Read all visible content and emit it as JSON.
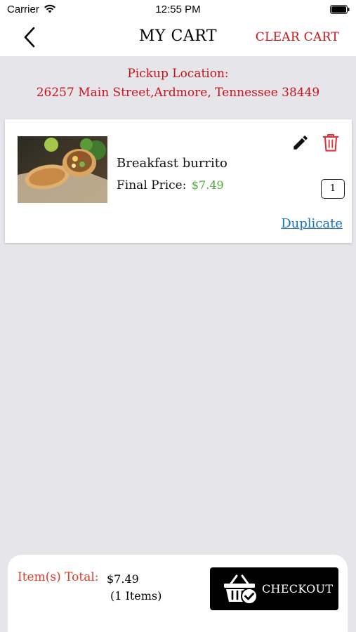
{
  "status": {
    "carrier": "Carrier",
    "time": "12:55 PM"
  },
  "header": {
    "title": "MY CART",
    "clear_label": "CLEAR CART",
    "back_icon": "chevron-left-icon"
  },
  "pickup": {
    "label": "Pickup Location:",
    "address": "26257 Main Street,Ardmore,  Tennessee 38449"
  },
  "cart": {
    "items": [
      {
        "name": "Breakfast burrito",
        "price_label": "Final Price:",
        "price": "$7.49",
        "quantity": "1",
        "duplicate_label": "Duplicate",
        "edit_icon": "pencil-icon",
        "delete_icon": "trash-icon"
      }
    ]
  },
  "footer": {
    "total_label": "Item(s) Total:",
    "total_value": "$7.49",
    "items_count": "(1 Items)",
    "checkout_label": "CHECKOUT",
    "checkout_icon": "basket-check-icon"
  },
  "colors": {
    "accent_red": "#c8131b",
    "price_green": "#4fa83a",
    "link_blue": "#1b6fc0",
    "background": "#e6e6ea"
  }
}
